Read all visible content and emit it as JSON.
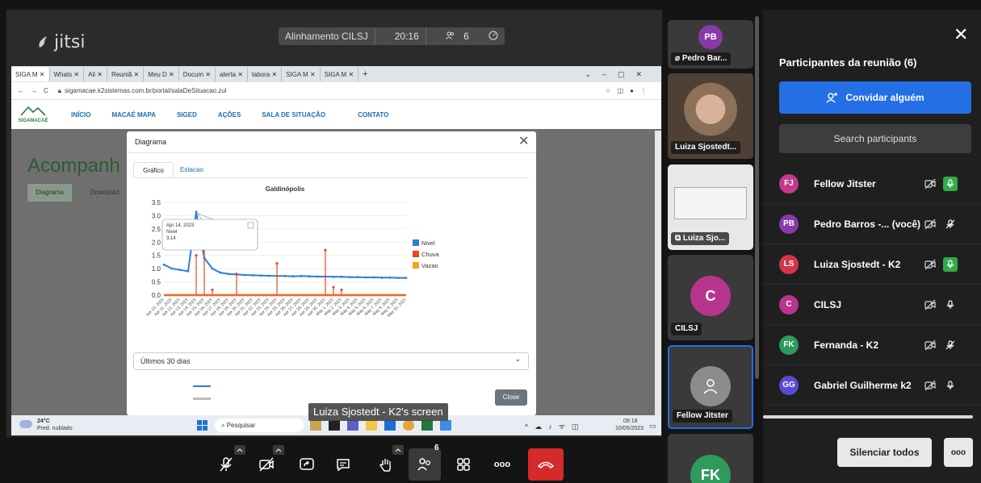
{
  "shared_screen": {
    "logo_text": "jitsi",
    "meeting_name": "Alinhamento CILSJ",
    "timer": "20:16",
    "participants_count": "6",
    "screen_owner_label": "Luiza Sjostedt - K2's screen"
  },
  "browser": {
    "tabs": [
      "SIGA M",
      "Whats",
      "Ali",
      "Reuniã",
      "Meu D",
      "Docum",
      "alerta",
      "labora",
      "SIGA M",
      "SIGA M"
    ],
    "new_tab": "+",
    "url": "sigamacae.k2sistemas.com.br/portal/salaDeSituacao.zul"
  },
  "site": {
    "logo_text": "SIGAMACAÉ",
    "nav": [
      "INÍCIO",
      "MACAÉ MAPA",
      "SIGED",
      "AÇÕES",
      "SALA DE SITUAÇÃO",
      "CONTATO"
    ],
    "page_title": "Acompanh",
    "page_tabs": [
      "Diagrama",
      "Download"
    ]
  },
  "modal": {
    "title": "Diagrama",
    "tabs": [
      "Gráfico",
      "Estacao"
    ],
    "period": "Últimos 30 dias",
    "close_label": "Close"
  },
  "chart_data": {
    "type": "line",
    "title": "Galdinópolis",
    "ylim": [
      0,
      3.5
    ],
    "yticks": [
      "0.0",
      "0.5",
      "1.0",
      "1.5",
      "2.0",
      "2.5",
      "3.0",
      "3.5"
    ],
    "x": [
      "Apr 10, 2023",
      "Apr 11, 2023",
      "Apr 12, 2023",
      "Apr 13, 2023",
      "Apr 14, 2023",
      "Apr 15, 2023",
      "Apr 16, 2023",
      "Apr 17, 2023",
      "Apr 18, 2023",
      "Apr 19, 2023",
      "Apr 20, 2023",
      "Apr 21, 2023",
      "Apr 22, 2023",
      "Apr 23, 2023",
      "Apr 24, 2023",
      "Apr 25, 2023",
      "Apr 26, 2023",
      "Apr 27, 2023",
      "Apr 28, 2023",
      "Apr 29, 2023",
      "Apr 30, 2023",
      "May 1, 2023",
      "May 2, 2023",
      "May 3, 2023",
      "May 4, 2023",
      "May 5, 2023",
      "May 6, 2023",
      "May 7, 2023",
      "May 8, 2023",
      "May 9, 2023",
      "May 10, 2023"
    ],
    "series": [
      {
        "name": "Nivel",
        "color": "#2f7ed8",
        "values": [
          1.15,
          1.0,
          0.95,
          0.9,
          3.14,
          1.4,
          1.0,
          0.85,
          0.8,
          0.78,
          0.76,
          0.75,
          0.74,
          0.73,
          0.72,
          0.72,
          0.71,
          0.72,
          0.71,
          0.7,
          0.7,
          0.69,
          0.69,
          0.68,
          0.68,
          0.67,
          0.67,
          0.66,
          0.66,
          0.65,
          0.65
        ]
      },
      {
        "name": "Chuva",
        "color": "#e8491d",
        "values": [
          0,
          0,
          0,
          0,
          1.5,
          2.0,
          0.2,
          0,
          0,
          0.8,
          0,
          0,
          0,
          0,
          1.2,
          0,
          0,
          0,
          0,
          0,
          1.7,
          0.3,
          0.2,
          0,
          0,
          0,
          0,
          0,
          0,
          0,
          0
        ]
      },
      {
        "name": "Vazao",
        "color": "#f7a21b",
        "values": [
          0,
          0,
          0,
          0,
          0,
          0,
          0,
          0,
          0,
          0,
          0,
          0,
          0,
          0,
          0,
          0,
          0,
          0,
          0,
          0,
          0,
          0,
          0,
          0,
          0,
          0,
          0,
          0,
          0,
          0,
          0
        ]
      }
    ],
    "tooltip": {
      "date": "Apr 14, 2023",
      "label": "Nivel",
      "value": "3.14"
    },
    "legend": "right"
  },
  "taskbar": {
    "weather_temp": "24°C",
    "weather_desc": "Pred. nublado",
    "search_label": "Pesquisar",
    "clock_time": "09:18",
    "clock_date": "10/05/2023"
  },
  "filmstrip": [
    {
      "initials": "PB",
      "name": "Pedro Bar...",
      "color": "#8a3aa6"
    },
    {
      "name": "Luiza Sjostedt..."
    },
    {
      "name": "Luiza Sjo..."
    },
    {
      "initials": "C",
      "name": "CILSJ",
      "color": "#b8358f"
    },
    {
      "name": "Fellow Jitster"
    },
    {
      "initials": "FK",
      "color": "#2e9a5c"
    }
  ],
  "panel": {
    "title": "Participantes da reunião (6)",
    "invite_label": "Convidar alguém",
    "search_placeholder": "Search participants",
    "participants": [
      {
        "initials": "FJ",
        "name": "Fellow Jitster",
        "color": "#c33a8c",
        "mic": "on"
      },
      {
        "initials": "PB",
        "name": "Pedro Barros -... (você)",
        "color": "#8a3aa6",
        "mic": "muted"
      },
      {
        "initials": "LS",
        "name": "Luiza Sjostedt - K2",
        "color": "#d2364a",
        "mic": "on"
      },
      {
        "initials": "C",
        "name": "CILSJ",
        "color": "#b8358f",
        "mic": "off"
      },
      {
        "initials": "FK",
        "name": "Fernanda - K2",
        "color": "#2e9a5c",
        "mic": "muted"
      },
      {
        "initials": "GG",
        "name": "Gabriel Guilherme k2",
        "color": "#5a4ad6",
        "mic": "off"
      }
    ],
    "mute_all_label": "Silenciar todos",
    "more_label": "ooo"
  },
  "toolbar": {
    "participants_badge": "6",
    "more_label": "ooo"
  }
}
